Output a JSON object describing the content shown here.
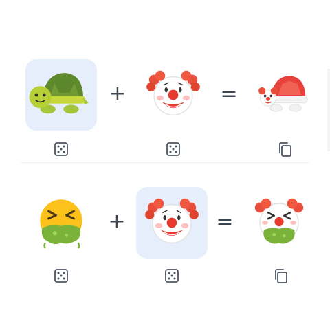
{
  "combos": [
    {
      "left": {
        "emoji": "turtle",
        "selected": true
      },
      "operator_plus": "+",
      "right": {
        "emoji": "clown-face",
        "selected": false
      },
      "operator_equals": "=",
      "result": {
        "emoji": "clown-turtle"
      },
      "left_tool": "dice-icon",
      "right_tool": "dice-icon",
      "result_tool": "copy-icon"
    },
    {
      "left": {
        "emoji": "face-vomiting",
        "selected": false
      },
      "operator_plus": "+",
      "right": {
        "emoji": "clown-face",
        "selected": true
      },
      "operator_equals": "=",
      "result": {
        "emoji": "clown-vomiting"
      },
      "left_tool": "dice-icon",
      "right_tool": "dice-icon",
      "result_tool": "copy-icon"
    }
  ],
  "colors": {
    "selected_bg": "#e6eefb",
    "icon_stroke": "#4b5563",
    "operator": "#3d4754"
  }
}
